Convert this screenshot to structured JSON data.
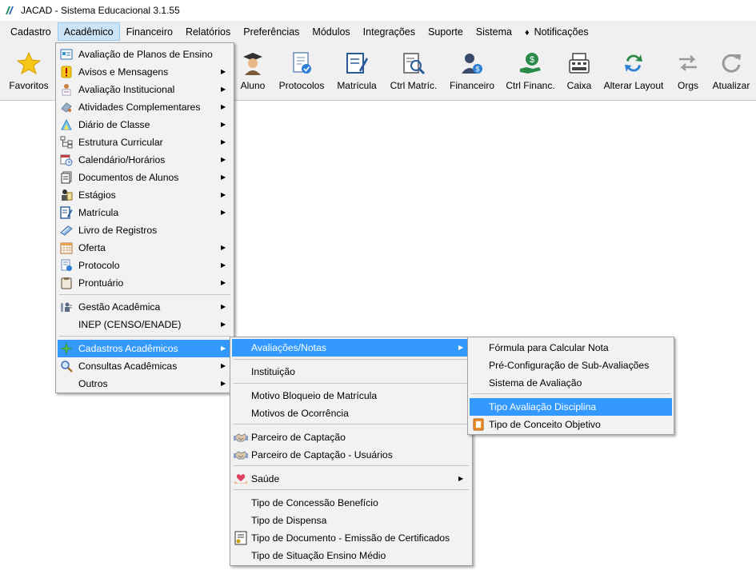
{
  "window": {
    "title": "JACAD - Sistema Educacional 3.1.55"
  },
  "menubar": {
    "items": [
      "Cadastro",
      "Acadêmico",
      "Financeiro",
      "Relatórios",
      "Preferências",
      "Módulos",
      "Integrações",
      "Suporte",
      "Sistema",
      "Notificações"
    ],
    "active": "Acadêmico"
  },
  "toolbar": {
    "buttons": [
      {
        "label": "Favoritos",
        "icon": "star-icon"
      },
      {
        "label": "Aluno",
        "icon": "graduate-icon"
      },
      {
        "label": "Protocolos",
        "icon": "protocol-icon"
      },
      {
        "label": "Matrícula",
        "icon": "enrollment-icon"
      },
      {
        "label": "Ctrl Matríc.",
        "icon": "enrollment-control-icon"
      },
      {
        "label": "Financeiro",
        "icon": "finance-icon"
      },
      {
        "label": "Ctrl Financ.",
        "icon": "finance-control-icon"
      },
      {
        "label": "Caixa",
        "icon": "cash-register-icon"
      },
      {
        "label": "Alterar Layout",
        "icon": "layout-icon"
      },
      {
        "label": "Orgs",
        "icon": "orgs-icon"
      },
      {
        "label": "Atualizar",
        "icon": "refresh-icon"
      }
    ]
  },
  "menu_academico": {
    "items": [
      {
        "label": "Avaliação de Planos de Ensino",
        "icon": "plan-icon",
        "submenu": false
      },
      {
        "label": "Avisos e Mensagens",
        "icon": "warning-icon",
        "submenu": true
      },
      {
        "label": "Avaliação Institucional",
        "icon": "person-form-icon",
        "submenu": true
      },
      {
        "label": "Atividades Complementares",
        "icon": "activity-icon",
        "submenu": true
      },
      {
        "label": "Diário de Classe",
        "icon": "diary-icon",
        "submenu": true
      },
      {
        "label": "Estrutura Curricular",
        "icon": "structure-icon",
        "submenu": true
      },
      {
        "label": "Calendário/Horários",
        "icon": "calendar-clock-icon",
        "submenu": true
      },
      {
        "label": "Documentos de Alunos",
        "icon": "documents-icon",
        "submenu": true
      },
      {
        "label": "Estágios",
        "icon": "internship-icon",
        "submenu": true
      },
      {
        "label": "Matrícula",
        "icon": "enrollment-icon",
        "submenu": true
      },
      {
        "label": "Livro de Registros",
        "icon": "book-icon",
        "submenu": false
      },
      {
        "label": "Oferta",
        "icon": "calendar-grid-icon",
        "submenu": true
      },
      {
        "label": "Protocolo",
        "icon": "protocol-icon",
        "submenu": true
      },
      {
        "label": "Prontuário",
        "icon": "clipboard-icon",
        "submenu": true
      },
      {
        "label": "Gestão Acadêmica",
        "icon": "management-icon",
        "submenu": true
      },
      {
        "label": "INEP (CENSO/ENADE)",
        "icon": "",
        "submenu": true
      },
      {
        "label": "Cadastros Acadêmicos",
        "icon": "sparkle-icon",
        "submenu": true
      },
      {
        "label": "Consultas Acadêmicas",
        "icon": "search-icon",
        "submenu": true
      },
      {
        "label": "Outros",
        "icon": "",
        "submenu": true
      }
    ],
    "highlighted": "Cadastros Acadêmicos"
  },
  "menu_cadastros": {
    "items": [
      {
        "label": "Avaliações/Notas",
        "icon": "",
        "submenu": true
      },
      {
        "label": "Instituição",
        "icon": "",
        "submenu": false
      },
      {
        "label": "Motivo Bloqueio de Matrícula",
        "icon": "",
        "submenu": false
      },
      {
        "label": "Motivos de Ocorrência",
        "icon": "",
        "submenu": false
      },
      {
        "label": "Parceiro de Captação",
        "icon": "handshake-icon",
        "submenu": false
      },
      {
        "label": "Parceiro de Captação - Usuários",
        "icon": "handshake-icon",
        "submenu": false
      },
      {
        "label": "Saúde",
        "icon": "heart-hands-icon",
        "submenu": true
      },
      {
        "label": "Tipo de Concessão Benefício",
        "icon": "",
        "submenu": false
      },
      {
        "label": "Tipo de Dispensa",
        "icon": "",
        "submenu": false
      },
      {
        "label": "Tipo de Documento - Emissão de Certificados",
        "icon": "certificate-doc-icon",
        "submenu": false
      },
      {
        "label": "Tipo de Situação Ensino Médio",
        "icon": "",
        "submenu": false
      }
    ],
    "highlighted": "Avaliações/Notas"
  },
  "menu_avaliacoes": {
    "items": [
      {
        "label": "Fórmula para Calcular Nota",
        "icon": ""
      },
      {
        "label": "Pré-Configuração de Sub-Avaliações",
        "icon": ""
      },
      {
        "label": "Sistema de Avaliação",
        "icon": ""
      },
      {
        "label": "Tipo Avaliação Disciplina",
        "icon": ""
      },
      {
        "label": "Tipo de Conceito Objetivo",
        "icon": "concept-icon"
      }
    ],
    "highlighted": "Tipo Avaliação Disciplina"
  }
}
